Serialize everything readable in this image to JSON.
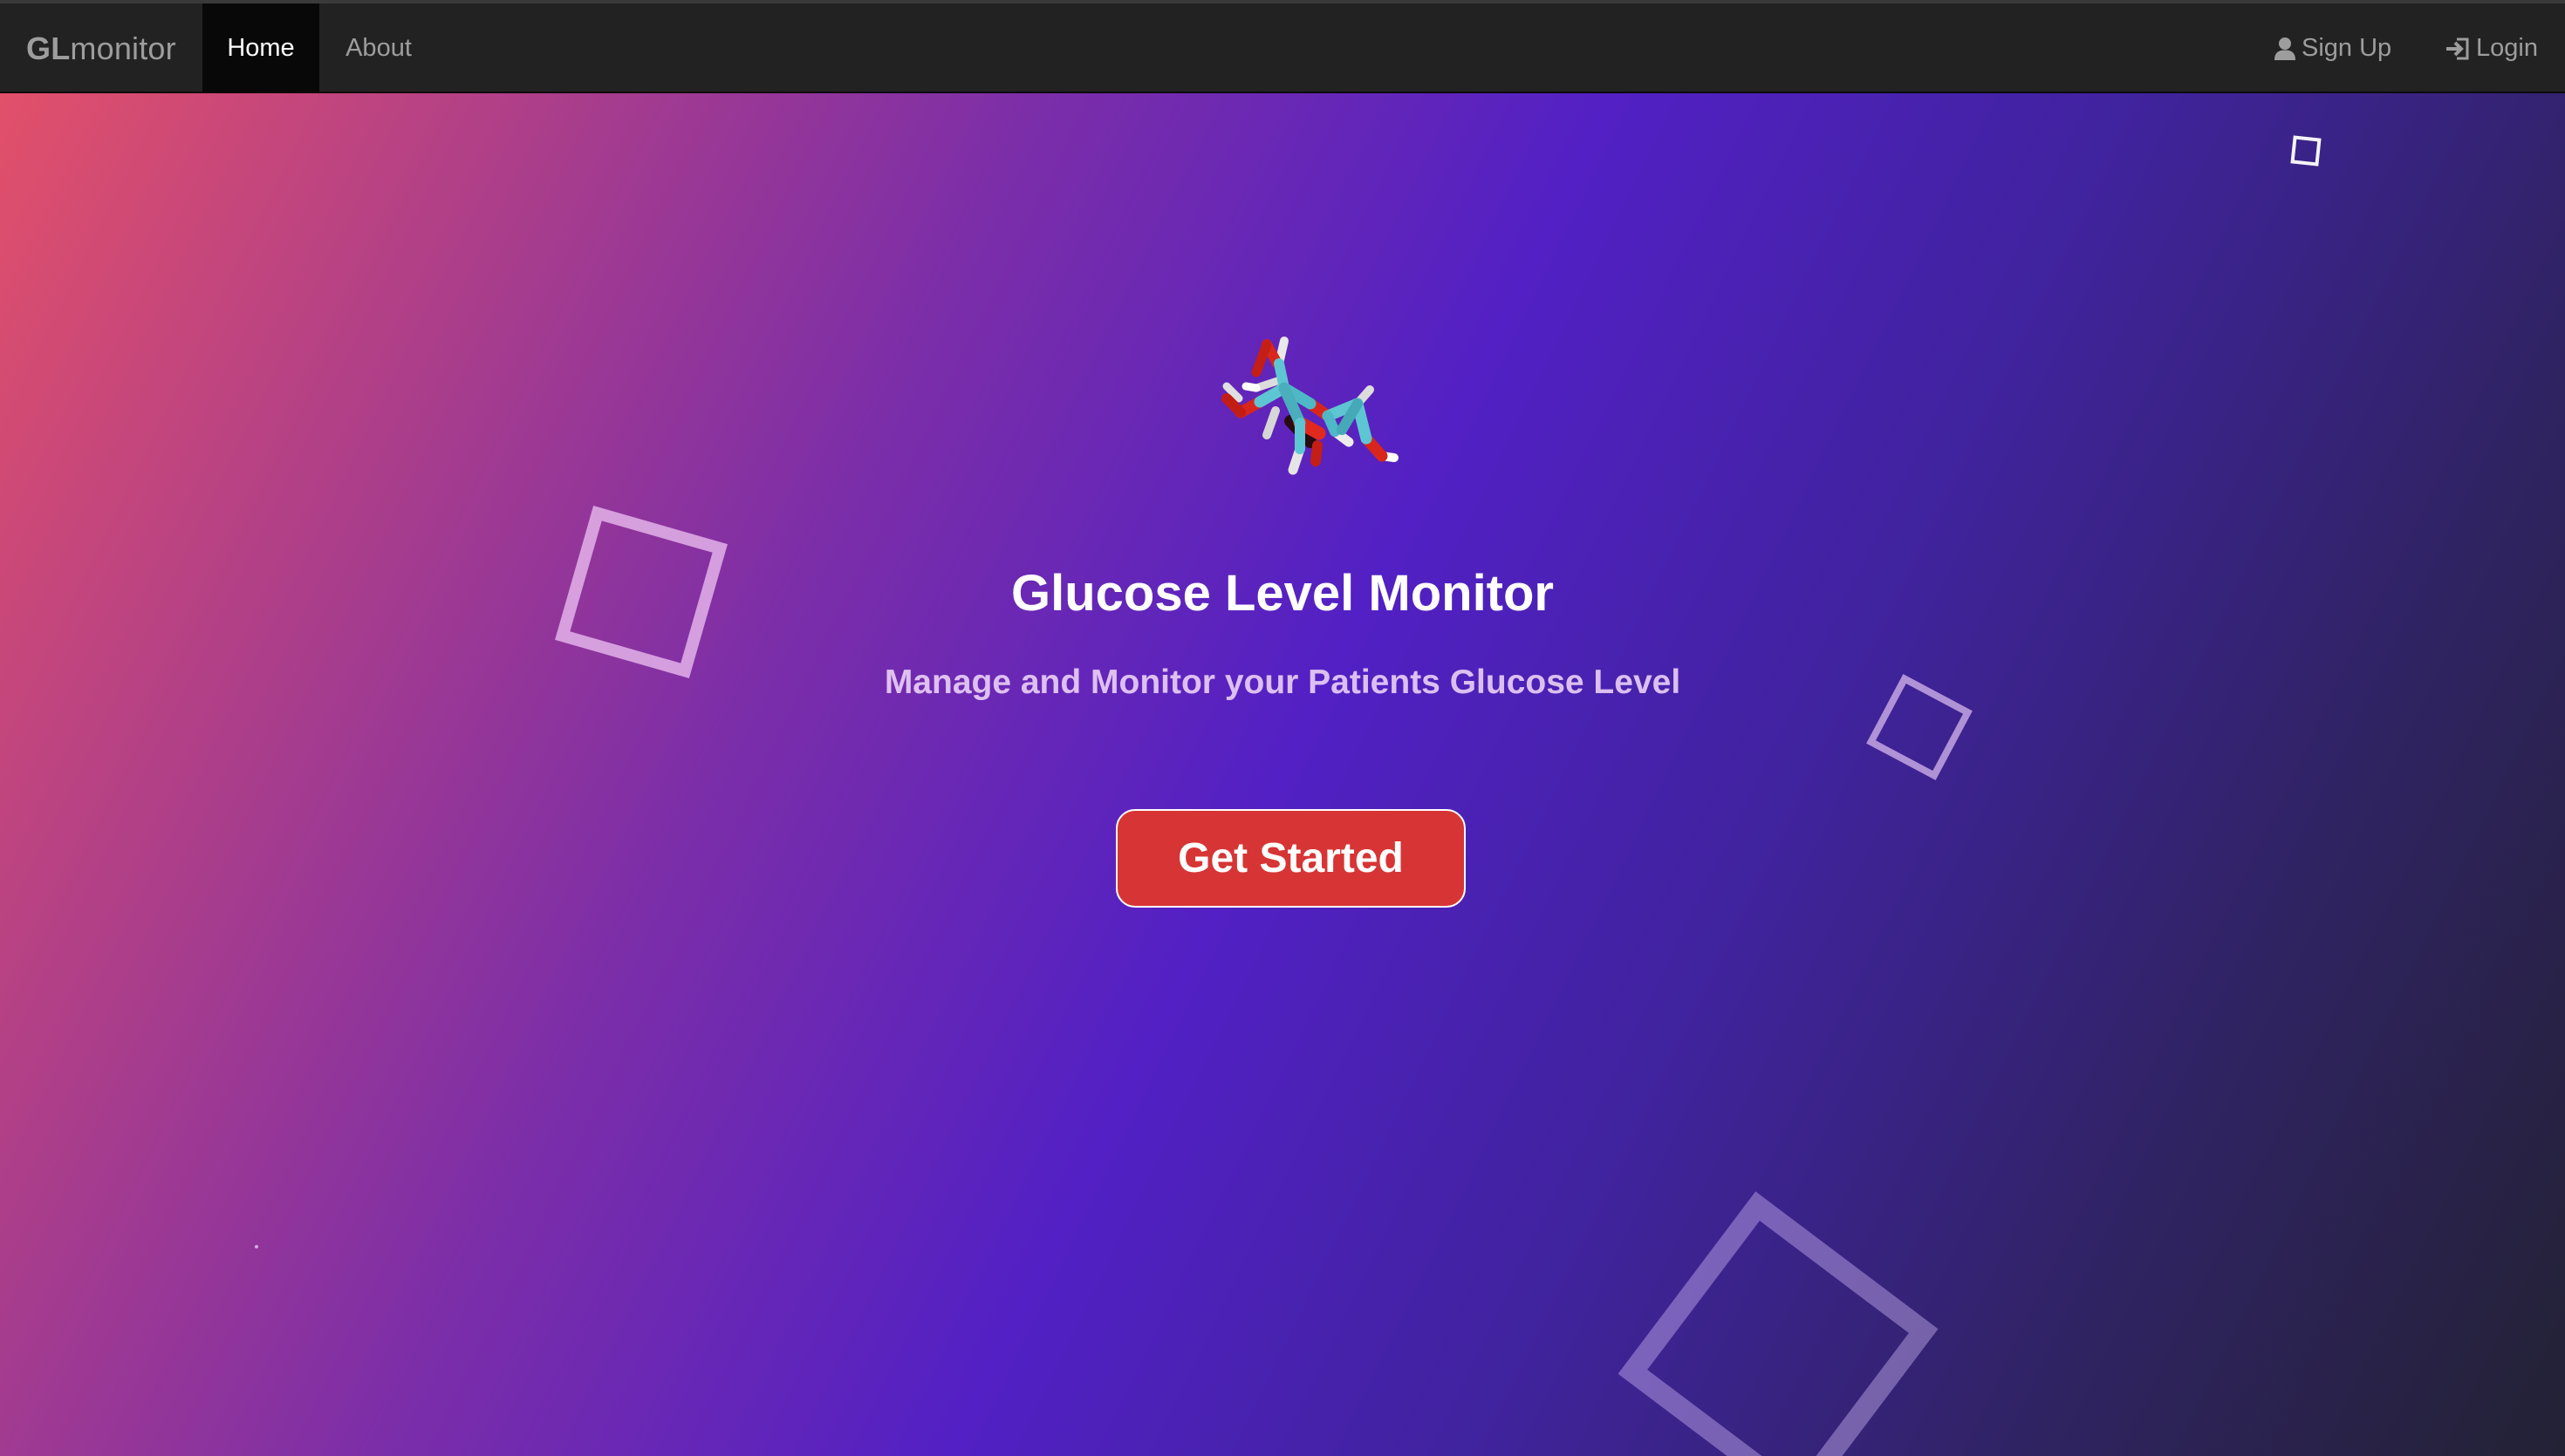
{
  "navbar": {
    "brand_bold": "GL",
    "brand_rest": "monitor",
    "links": [
      {
        "label": "Home",
        "active": true
      },
      {
        "label": "About",
        "active": false
      }
    ],
    "right_links": [
      {
        "label": "Sign Up",
        "icon": "user-icon"
      },
      {
        "label": "Login",
        "icon": "login-icon"
      }
    ]
  },
  "hero": {
    "image": "glucose-molecule",
    "title": "Glucose Level Monitor",
    "subtitle": "Manage and Monitor your Patients Glucose Level",
    "cta_label": "Get Started"
  },
  "colors": {
    "navbar_bg": "#222222",
    "active_tab_bg": "#080808",
    "cta_bg": "#d73535",
    "gradient_start": "#e2506a",
    "gradient_mid": "#5220c4",
    "gradient_end": "#232234"
  }
}
